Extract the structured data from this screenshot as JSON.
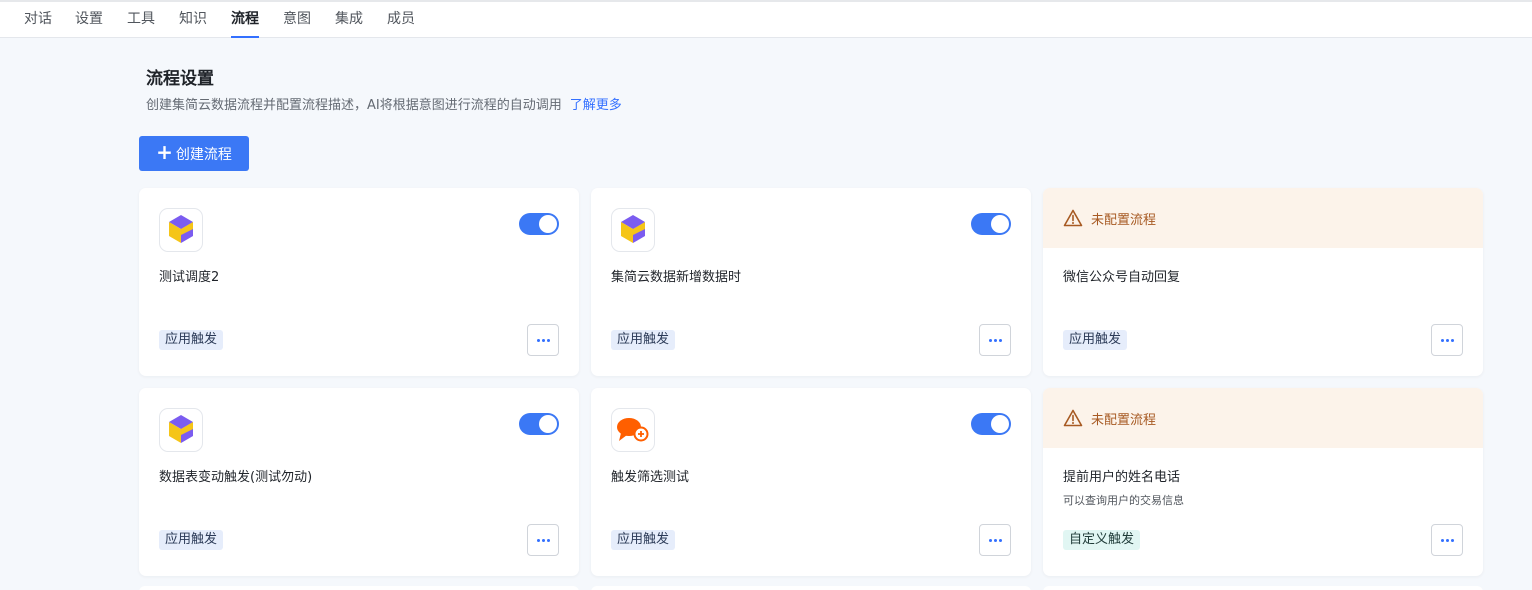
{
  "tabs": [
    {
      "label": "对话",
      "active": false
    },
    {
      "label": "设置",
      "active": false
    },
    {
      "label": "工具",
      "active": false
    },
    {
      "label": "知识",
      "active": false
    },
    {
      "label": "流程",
      "active": true
    },
    {
      "label": "意图",
      "active": false
    },
    {
      "label": "集成",
      "active": false
    },
    {
      "label": "成员",
      "active": false
    }
  ],
  "page": {
    "title": "流程设置",
    "description": "创建集简云数据流程并配置流程描述，AI将根据意图进行流程的自动调用",
    "learn_more": "了解更多",
    "create_button": "创建流程",
    "create_icon": "plus-icon"
  },
  "cards": [
    {
      "name": "测试调度2",
      "tag": "应用触发",
      "logo": "jijianyun-logo-icon",
      "enabled": true
    },
    {
      "name": "集简云数据新增数据时",
      "tag": "应用触发",
      "logo": "jijianyun-logo-icon",
      "enabled": true
    },
    {
      "warning": "未配置流程",
      "warning_icon": "warning-triangle-icon",
      "name": "微信公众号自动回复",
      "tag": "应用触发"
    },
    {
      "name": "数据表变动触发(测试勿动)",
      "tag": "应用触发",
      "logo": "jijianyun-logo-icon",
      "enabled": true
    },
    {
      "name": "触发筛选测试",
      "tag": "应用触发",
      "logo": "chat-bubble-logo-icon",
      "enabled": true
    },
    {
      "warning": "未配置流程",
      "warning_icon": "warning-triangle-icon",
      "name": "提前用户的姓名电话",
      "subtitle": "可以查询用户的交易信息",
      "tag": "自定义触发"
    }
  ],
  "colors": {
    "accent": "#3b78f5",
    "warning_bg": "#fcf3ea",
    "warning_text": "#a75a23",
    "tag_app_bg": "#e6edfb",
    "tag_custom_bg": "#e1f6f3",
    "logo_yellow": "#f5c518",
    "logo_purple": "#7b5cf0",
    "bubble_orange": "#ff5f00"
  }
}
